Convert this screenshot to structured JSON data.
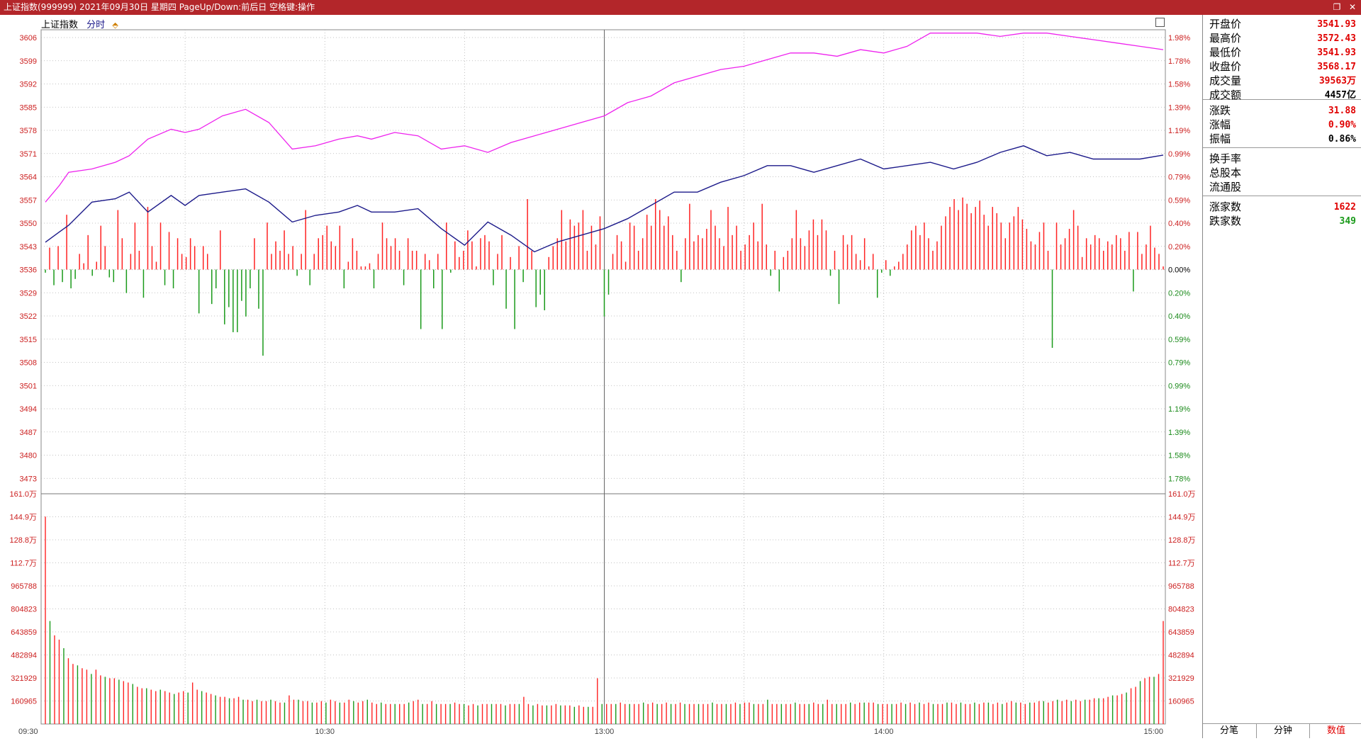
{
  "window": {
    "title": "上证指数(999999) 2021年09月30日 星期四 PageUp/Down:前后日 空格键:操作"
  },
  "legend": {
    "name": "上证指数",
    "tab": "分时"
  },
  "colors": {
    "up": "#ff2222",
    "down": "#1a9a1a",
    "price_line": "#1c1a8a",
    "avg_line": "#ee22ee",
    "grid": "#b0b0b0",
    "axis_text_left": "#cc2020",
    "axis_text_right_up": "#cc2020",
    "axis_text_right_down": "#1a8a1a",
    "title_bg": "#b3262a"
  },
  "icons": {
    "minimize": "restore-icon",
    "close": "close-icon",
    "legend": "diamond-icon",
    "expand": "expand-icon"
  },
  "side": {
    "stats1": [
      {
        "label": "开盘价",
        "value": "3541.93",
        "color": "#e00000"
      },
      {
        "label": "最高价",
        "value": "3572.43",
        "color": "#e00000"
      },
      {
        "label": "最低价",
        "value": "3541.93",
        "color": "#e00000"
      },
      {
        "label": "收盘价",
        "value": "3568.17",
        "color": "#e00000"
      },
      {
        "label": "成交量",
        "value": "39563万",
        "color": "#e00000"
      },
      {
        "label": "成交额",
        "value": "4457亿",
        "color": "#000000"
      }
    ],
    "stats2": [
      {
        "label": "涨跌",
        "value": "31.88",
        "color": "#e00000"
      },
      {
        "label": "涨幅",
        "value": "0.90%",
        "color": "#e00000"
      },
      {
        "label": "振幅",
        "value": "0.86%",
        "color": "#000000"
      }
    ],
    "stats3": [
      {
        "label": "换手率",
        "value": "",
        "color": "#000000"
      },
      {
        "label": "总股本",
        "value": "",
        "color": "#000000"
      },
      {
        "label": "流通股",
        "value": "",
        "color": "#000000"
      }
    ],
    "stats4": [
      {
        "label": "涨家数",
        "value": "1622",
        "color": "#e00000"
      },
      {
        "label": "跌家数",
        "value": "349",
        "color": "#1a9a1a"
      }
    ],
    "tabs": [
      "分笔",
      "分钟",
      "数值"
    ],
    "active_tab": 2
  },
  "chart_data": {
    "type": "line",
    "price_axis": {
      "ticks": [
        "3606",
        "3599",
        "3592",
        "3585",
        "3578",
        "3571",
        "3564",
        "3557",
        "3550",
        "3543",
        "3536",
        "3529",
        "3522",
        "3515",
        "3508",
        "3501",
        "3494",
        "3487",
        "3480",
        "3473"
      ],
      "pct_ticks": [
        "1.98%",
        "1.78%",
        "1.58%",
        "1.39%",
        "1.19%",
        "0.99%",
        "0.79%",
        "0.59%",
        "0.40%",
        "0.20%",
        "0.00%",
        "0.20%",
        "0.40%",
        "0.59%",
        "0.79%",
        "0.99%",
        "1.19%",
        "1.39%",
        "1.58%",
        "1.78%"
      ],
      "ylim": [
        3466,
        3606
      ],
      "base": 3536.29
    },
    "volume_axis": {
      "ticks": [
        "161.0万",
        "144.9万",
        "128.8万",
        "112.7万",
        "965788",
        "804823",
        "643859",
        "482894",
        "321929",
        "160965"
      ],
      "ylim": [
        0,
        1610000
      ]
    },
    "x_ticks": [
      {
        "label": "09:30",
        "minute": 0
      },
      {
        "label": "10:30",
        "minute": 60
      },
      {
        "label": "13:00",
        "minute": 120
      },
      {
        "label": "14:00",
        "minute": 180
      },
      {
        "label": "15:00",
        "minute": 240
      }
    ],
    "series": [
      {
        "name": "",
        "kind": "index_price",
        "x": [
          0,
          3,
          5,
          10,
          15,
          18,
          22,
          27,
          30,
          33,
          38,
          43,
          48,
          53,
          58,
          63,
          67,
          70,
          75,
          80,
          85,
          90,
          95,
          100,
          105,
          110,
          115,
          120,
          125,
          130,
          135,
          140,
          145,
          150,
          155,
          160,
          165,
          170,
          175,
          180,
          185,
          190,
          195,
          200,
          205,
          210,
          215,
          220,
          225,
          230,
          235,
          240
        ],
        "values": [
          3541.9,
          3545,
          3547,
          3554,
          3555,
          3557,
          3551,
          3556,
          3553,
          3556,
          3557,
          3558,
          3554,
          3548,
          3550,
          3551,
          3553,
          3551,
          3551,
          3552,
          3546,
          3541,
          3548,
          3544,
          3539,
          3542,
          3544,
          3546,
          3549,
          3553,
          3557,
          3557,
          3560,
          3562,
          3565,
          3565,
          3563,
          3565,
          3567,
          3564,
          3565,
          3566,
          3564,
          3566,
          3569,
          3571,
          3568,
          3569,
          3567,
          3567,
          3567,
          3568.2
        ]
      },
      {
        "name": "",
        "kind": "avg_price",
        "x": [
          0,
          3,
          5,
          10,
          15,
          18,
          22,
          27,
          30,
          33,
          38,
          43,
          48,
          53,
          58,
          63,
          67,
          70,
          75,
          80,
          85,
          90,
          95,
          100,
          105,
          110,
          115,
          120,
          125,
          130,
          135,
          140,
          145,
          150,
          155,
          160,
          165,
          170,
          175,
          180,
          185,
          190,
          195,
          200,
          205,
          210,
          215,
          220,
          225,
          230,
          235,
          240
        ],
        "values": [
          3554,
          3559,
          3563,
          3564,
          3566,
          3568,
          3573,
          3576,
          3575,
          3576,
          3580,
          3582,
          3578,
          3570,
          3571,
          3573,
          3574,
          3573,
          3575,
          3574,
          3570,
          3571,
          3569,
          3572,
          3574,
          3576,
          3578,
          3580,
          3584,
          3586,
          3590,
          3592,
          3594,
          3595,
          3597,
          3599,
          3599,
          3598,
          3600,
          3599,
          3601,
          3605,
          3605,
          3605,
          3604,
          3605,
          3605,
          3604,
          3603,
          3602,
          3601,
          3600
        ]
      },
      {
        "name": "",
        "kind": "breadth_bars",
        "note_values_are_percent_units": true,
        "values": [
          -2,
          14,
          -10,
          15,
          -8,
          35,
          -12,
          -6,
          10,
          4,
          22,
          -4,
          5,
          28,
          15,
          -5,
          -8,
          38,
          20,
          -15,
          10,
          30,
          12,
          -18,
          40,
          15,
          5,
          30,
          -10,
          24,
          -12,
          20,
          10,
          8,
          20,
          15,
          -28,
          15,
          10,
          -22,
          -12,
          25,
          -35,
          -24,
          -40,
          -40,
          -20,
          -30,
          -12,
          20,
          -25,
          -55,
          30,
          10,
          18,
          12,
          25,
          10,
          15,
          -4,
          10,
          38,
          -10,
          10,
          20,
          22,
          28,
          18,
          15,
          28,
          -12,
          5,
          20,
          12,
          2,
          2,
          4,
          -12,
          10,
          30,
          20,
          15,
          20,
          12,
          -10,
          20,
          12,
          12,
          -38,
          10,
          6,
          -12,
          10,
          -38,
          30,
          -2,
          18,
          8,
          12,
          25,
          18,
          2,
          20,
          22,
          18,
          -10,
          10,
          22,
          -25,
          8,
          -38,
          15,
          -8,
          45,
          12,
          -24,
          -16,
          -26,
          8,
          15,
          20,
          38,
          18,
          32,
          28,
          30,
          38,
          12,
          28,
          16,
          34,
          -30,
          -16,
          10,
          22,
          18,
          5,
          30,
          28,
          12,
          20,
          35,
          28,
          45,
          38,
          28,
          34,
          22,
          12,
          -8,
          20,
          42,
          18,
          22,
          20,
          26,
          38,
          28,
          20,
          15,
          40,
          22,
          28,
          12,
          16,
          22,
          30,
          18,
          42,
          16,
          -4,
          12,
          -14,
          8,
          12,
          20,
          38,
          20,
          15,
          25,
          32,
          22,
          32,
          25,
          -4,
          12,
          -22,
          22,
          16,
          22,
          10,
          6,
          20,
          2,
          10,
          -18,
          -2,
          6,
          -4,
          2,
          5,
          10,
          16,
          25,
          28,
          22,
          30,
          20,
          12,
          18,
          28,
          34,
          40,
          45,
          38,
          46,
          42,
          36,
          40,
          44,
          35,
          28,
          40,
          36,
          30,
          20,
          30,
          34,
          40,
          32,
          26,
          18,
          16,
          24,
          30,
          12,
          -50,
          30,
          16,
          20,
          26,
          38,
          28,
          8,
          20,
          16,
          22,
          20,
          12,
          18,
          16,
          22,
          20,
          12,
          24,
          -14,
          24,
          10,
          16,
          28,
          14,
          10,
          2
        ]
      },
      {
        "name": "",
        "kind": "volume",
        "values": [
          1450000,
          720000,
          620000,
          590000,
          530000,
          460000,
          420000,
          410000,
          390000,
          380000,
          350000,
          380000,
          340000,
          330000,
          320000,
          320000,
          310000,
          300000,
          290000,
          280000,
          260000,
          250000,
          250000,
          240000,
          230000,
          240000,
          230000,
          220000,
          210000,
          220000,
          230000,
          220000,
          290000,
          240000,
          230000,
          220000,
          210000,
          200000,
          190000,
          190000,
          180000,
          180000,
          190000,
          170000,
          170000,
          160000,
          170000,
          160000,
          160000,
          170000,
          160000,
          150000,
          150000,
          200000,
          170000,
          170000,
          160000,
          160000,
          150000,
          150000,
          160000,
          150000,
          170000,
          160000,
          150000,
          150000,
          170000,
          160000,
          150000,
          160000,
          170000,
          150000,
          140000,
          150000,
          140000,
          140000,
          140000,
          140000,
          140000,
          150000,
          160000,
          170000,
          140000,
          140000,
          160000,
          140000,
          140000,
          140000,
          140000,
          150000,
          140000,
          140000,
          130000,
          140000,
          130000,
          140000,
          140000,
          140000,
          140000,
          140000,
          130000,
          140000,
          140000,
          140000,
          190000,
          140000,
          130000,
          140000,
          130000,
          130000,
          130000,
          140000,
          130000,
          130000,
          130000,
          120000,
          130000,
          120000,
          120000,
          120000,
          320000,
          140000,
          140000,
          140000,
          140000,
          150000,
          140000,
          140000,
          140000,
          140000,
          150000,
          140000,
          150000,
          140000,
          140000,
          150000,
          140000,
          140000,
          150000,
          140000,
          140000,
          140000,
          140000,
          140000,
          140000,
          150000,
          140000,
          140000,
          140000,
          140000,
          150000,
          140000,
          150000,
          150000,
          140000,
          140000,
          140000,
          170000,
          140000,
          140000,
          140000,
          140000,
          140000,
          150000,
          140000,
          140000,
          140000,
          150000,
          140000,
          140000,
          170000,
          140000,
          140000,
          140000,
          140000,
          150000,
          140000,
          150000,
          150000,
          150000,
          150000,
          140000,
          140000,
          140000,
          140000,
          140000,
          150000,
          140000,
          150000,
          140000,
          150000,
          140000,
          150000,
          140000,
          140000,
          140000,
          150000,
          150000,
          140000,
          150000,
          140000,
          140000,
          150000,
          140000,
          150000,
          150000,
          140000,
          150000,
          140000,
          150000,
          160000,
          150000,
          150000,
          140000,
          150000,
          150000,
          160000,
          160000,
          150000,
          160000,
          170000,
          160000,
          170000,
          160000,
          170000,
          160000,
          170000,
          170000,
          180000,
          180000,
          180000,
          190000,
          200000,
          200000,
          210000,
          220000,
          250000,
          260000,
          300000,
          320000,
          330000,
          330000,
          350000,
          720000
        ]
      }
    ],
    "xlim": [
      0,
      240
    ],
    "grid": true
  }
}
